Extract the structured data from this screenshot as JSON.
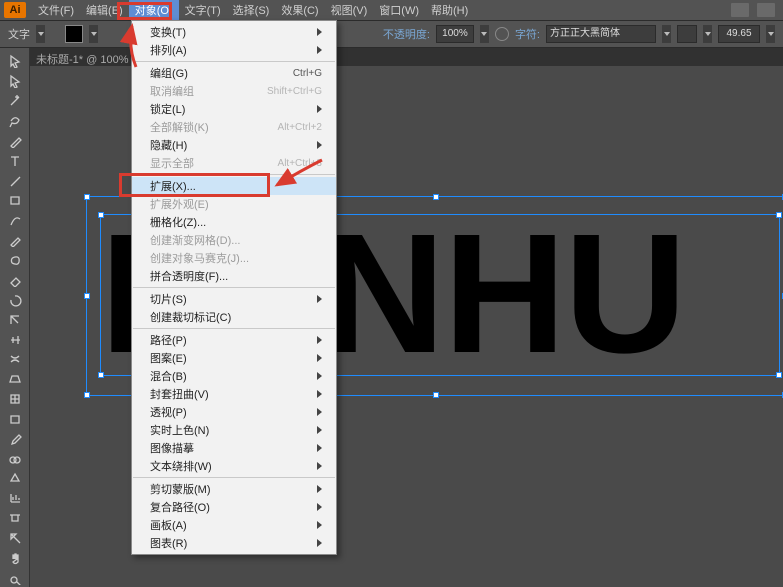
{
  "app_logo": "Ai",
  "menubar": [
    "文件(F)",
    "编辑(E)",
    "对象(O)",
    "文字(T)",
    "选择(S)",
    "效果(C)",
    "视图(V)",
    "窗口(W)",
    "帮助(H)"
  ],
  "menubar_active_index": 2,
  "optionsbar": {
    "tool_label": "文字",
    "opacity_label": "不透明度:",
    "opacity_value": "100%",
    "char_label": "字符:",
    "font_name": "方正正大黑简体",
    "size_value": "49.65"
  },
  "tab": {
    "title": "未标题-1* @ 100%"
  },
  "canvas": {
    "text_content": "LANHU"
  },
  "tools": [
    "arrow",
    "direct",
    "wand",
    "lasso",
    "pen",
    "type",
    "line",
    "rect",
    "brush",
    "pencil",
    "blob",
    "eraser",
    "rotate",
    "scale",
    "width",
    "warp",
    "shape",
    "mesh",
    "gradient",
    "eyedrop",
    "blend",
    "symbol",
    "graph",
    "artboard",
    "slice",
    "hand",
    "zoom"
  ],
  "dropdown": {
    "items": [
      {
        "label": "变换(T)",
        "sub": true
      },
      {
        "label": "排列(A)",
        "sub": true
      },
      {
        "type": "sep"
      },
      {
        "label": "编组(G)",
        "shortcut": "Ctrl+G"
      },
      {
        "label": "取消编组",
        "shortcut": "Shift+Ctrl+G",
        "disabled": true
      },
      {
        "label": "锁定(L)",
        "sub": true
      },
      {
        "label": "全部解锁(K)",
        "shortcut": "Alt+Ctrl+2",
        "disabled": true
      },
      {
        "label": "隐藏(H)",
        "sub": true
      },
      {
        "label": "显示全部",
        "shortcut": "Alt+Ctrl+3",
        "disabled": true
      },
      {
        "type": "sep"
      },
      {
        "label": "扩展(X)...",
        "hover": true
      },
      {
        "label": "扩展外观(E)",
        "disabled": true
      },
      {
        "label": "栅格化(Z)..."
      },
      {
        "label": "创建渐变网格(D)...",
        "disabled": true
      },
      {
        "label": "创建对象马赛克(J)...",
        "disabled": true
      },
      {
        "label": "拼合透明度(F)..."
      },
      {
        "type": "sep"
      },
      {
        "label": "切片(S)",
        "sub": true
      },
      {
        "label": "创建裁切标记(C)"
      },
      {
        "type": "sep"
      },
      {
        "label": "路径(P)",
        "sub": true
      },
      {
        "label": "图案(E)",
        "sub": true
      },
      {
        "label": "混合(B)",
        "sub": true
      },
      {
        "label": "封套扭曲(V)",
        "sub": true
      },
      {
        "label": "透视(P)",
        "sub": true
      },
      {
        "label": "实时上色(N)",
        "sub": true
      },
      {
        "label": "图像描摹",
        "sub": true
      },
      {
        "label": "文本绕排(W)",
        "sub": true
      },
      {
        "type": "sep"
      },
      {
        "label": "剪切蒙版(M)",
        "sub": true
      },
      {
        "label": "复合路径(O)",
        "sub": true
      },
      {
        "label": "画板(A)",
        "sub": true
      },
      {
        "label": "图表(R)",
        "sub": true
      }
    ]
  }
}
